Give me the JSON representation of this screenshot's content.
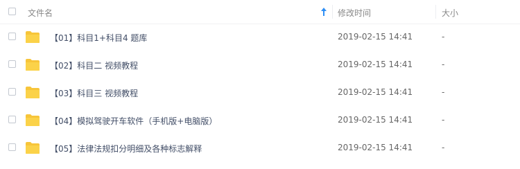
{
  "header": {
    "name_label": "文件名",
    "time_label": "修改时间",
    "size_label": "大小",
    "sort_icon": "arrow-up-icon",
    "sort_color": "#2f8ff5"
  },
  "folder_color": "#f7c53a",
  "files": [
    {
      "name": "【01】科目1+科目4 题库",
      "time": "2019-02-15 14:41",
      "size": "-"
    },
    {
      "name": "【02】科目二 视频教程",
      "time": "2019-02-15 14:41",
      "size": "-"
    },
    {
      "name": "【03】科目三 视频教程",
      "time": "2019-02-15 14:41",
      "size": "-"
    },
    {
      "name": "【04】模拟驾驶开车软件（手机版+电脑版）",
      "time": "2019-02-15 14:41",
      "size": "-"
    },
    {
      "name": "【05】法律法规扣分明细及各种标志解释",
      "time": "2019-02-15 14:41",
      "size": "-"
    }
  ]
}
